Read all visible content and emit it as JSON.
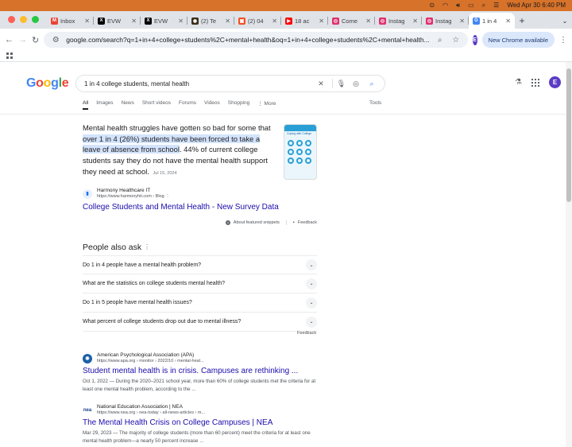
{
  "menubar": {
    "datetime": "Wed Apr 30  6:40 PM"
  },
  "tabs": [
    {
      "label": "Inbox",
      "icon": "gmail-icon",
      "color": "#ea4335",
      "glyph": "M"
    },
    {
      "label": "EVW",
      "icon": "x-icon",
      "color": "#000000",
      "glyph": "X"
    },
    {
      "label": "EVW",
      "icon": "x-icon",
      "color": "#000000",
      "glyph": "X"
    },
    {
      "label": "(2) Te",
      "icon": "app-icon",
      "color": "#3a2d1a",
      "glyph": "◉"
    },
    {
      "label": "(2) 04",
      "icon": "app-icon",
      "color": "#f25022",
      "glyph": "▣"
    },
    {
      "label": "18 ac",
      "icon": "youtube-icon",
      "color": "#ff0000",
      "glyph": "▶"
    },
    {
      "label": "Come",
      "icon": "instagram-icon",
      "color": "#e1306c",
      "glyph": "◎"
    },
    {
      "label": "Instag",
      "icon": "instagram-icon",
      "color": "#e1306c",
      "glyph": "◎"
    },
    {
      "label": "Instag",
      "icon": "instagram-icon",
      "color": "#e1306c",
      "glyph": "◎"
    },
    {
      "label": "1 in 4",
      "icon": "google-icon",
      "color": "#4285f4",
      "glyph": "G",
      "active": true
    }
  ],
  "toolbar": {
    "url": "google.com/search?q=1+in+4+college+students%2C+mental+health&oq=1+in+4+college+students%2C+mental+health...",
    "profile_initial": "E",
    "update_label": "New Chrome available"
  },
  "google": {
    "logo": "Google",
    "query": "1 in 4 college students, mental health",
    "profile_initial": "E",
    "vertical_tabs": [
      "All",
      "Images",
      "News",
      "Short videos",
      "Forums",
      "Videos",
      "Shopping",
      "⋮ More"
    ],
    "tools_label": "Tools"
  },
  "snippet": {
    "before": "Mental health struggles have gotten so bad for some that ",
    "highlight": "over 1 in 4 (26%) students have been forced to take a leave of absence from school",
    "after": ". 44% of current college students say they do not have the mental health support they need at school.",
    "date": "Jul 15, 2024",
    "source_site": "Harmony Healthcare IT",
    "source_crumb": "https://www.harmonyhit.com › Blog",
    "title": "College Students and Mental Health - New Survey Data",
    "about_label": "About featured snippets",
    "feedback_label": "Feedback",
    "thumb_caption": "Coping with College"
  },
  "people_also_ask": {
    "title": "People also ask",
    "questions": [
      "Do 1 in 4 people have a mental health problem?",
      "What are the statistics on college students mental health?",
      "Do 1 in 5 people have mental health issues?",
      "What percent of college students drop out due to mental illness?"
    ],
    "feedback_label": "Feedback"
  },
  "results": [
    {
      "site": "American Psychological Association (APA)",
      "crumb": "https://www.apa.org › monitor › 2022/10 › mental-heal...",
      "title": "Student mental health is in crisis. Campuses are rethinking ...",
      "desc": "Oct 1, 2022 — During the 2020–2021 school year, more than 60% of college students met the criteria for at least one mental health problem, according to the ...",
      "favicon_color": "#1a5fa8",
      "favicon_glyph": "◉"
    },
    {
      "site": "National Education Association | NEA",
      "crumb": "https://www.nea.org › nea-today › all-news-articles › m...",
      "title": "The Mental Health Crisis on College Campuses | NEA",
      "desc": "Mar 29, 2023 — The majority of college students (more than 60 percent) meet the criteria for at least one mental health problem—a nearly 50 percent increase ...",
      "favicon_color": "#ffffff",
      "favicon_glyph": "nea"
    }
  ]
}
